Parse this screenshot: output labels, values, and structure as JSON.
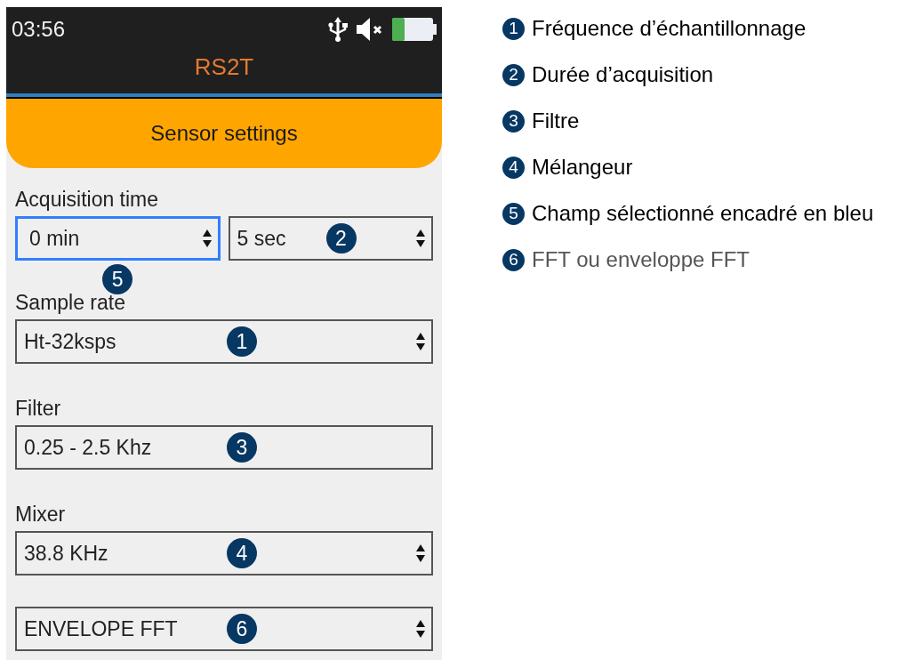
{
  "status_bar": {
    "time": "03:56"
  },
  "title": "RS2T",
  "header": "Sensor settings",
  "fields": [
    {
      "label": "Acquisition time",
      "controls": [
        {
          "kind": "select",
          "value": "0 min",
          "selected": true,
          "callout_below": "5"
        },
        {
          "kind": "select",
          "value": "5 sec",
          "selected": false,
          "callout": "2"
        }
      ]
    },
    {
      "label": "Sample rate",
      "controls": [
        {
          "kind": "select",
          "value": "Ht-32ksps",
          "selected": false,
          "callout": "1"
        }
      ]
    },
    {
      "label": "Filter",
      "controls": [
        {
          "kind": "readonly",
          "value": "0.25 - 2.5 Khz",
          "selected": false,
          "callout": "3"
        }
      ]
    },
    {
      "label": "Mixer",
      "controls": [
        {
          "kind": "select",
          "value": "38.8 KHz",
          "selected": false,
          "callout": "4"
        }
      ]
    },
    {
      "controls": [
        {
          "kind": "select",
          "value": "ENVELOPE FFT",
          "selected": false,
          "callout": "6"
        }
      ]
    }
  ],
  "legend": [
    {
      "number": "1",
      "text": "Fréquence d’échantillonnage",
      "muted": false
    },
    {
      "number": "2",
      "text": "Durée d’acquisition",
      "muted": false
    },
    {
      "number": "3",
      "text": "Filtre",
      "muted": false
    },
    {
      "number": "4",
      "text": "Mélangeur",
      "muted": false
    },
    {
      "number": "5",
      "text": "Champ sélectionné encadré en bleu",
      "muted": false
    },
    {
      "number": "6",
      "text": "FFT ou enveloppe FFT",
      "muted": true
    }
  ]
}
